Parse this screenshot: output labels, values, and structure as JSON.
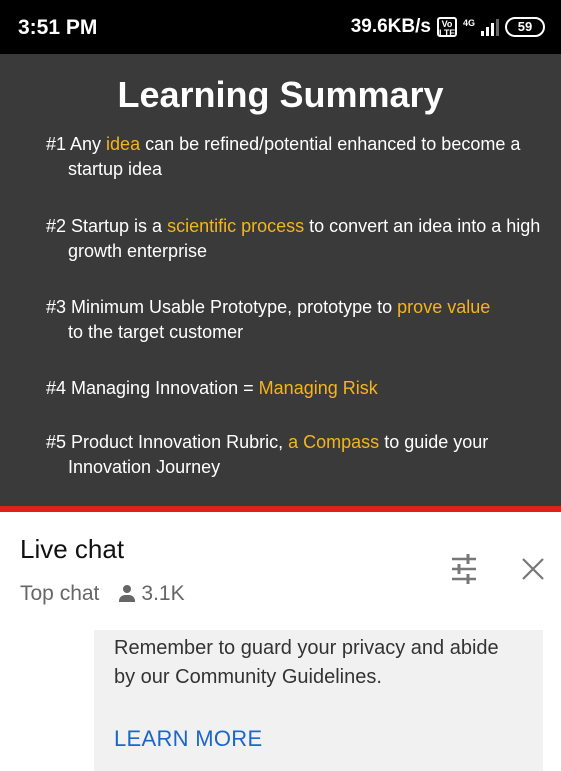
{
  "status_bar": {
    "time": "3:51 PM",
    "speed": "39.6KB/s",
    "volte": "Vo LTE",
    "network": "4G",
    "battery": "59"
  },
  "slide": {
    "title": "Learning Summary",
    "points": [
      {
        "prefix": "#1 Any ",
        "highlight": "idea",
        "suffix": " can be refined/potential enhanced to become a",
        "line2": "startup idea"
      },
      {
        "prefix": "#2 Startup is a ",
        "highlight": "scientific process",
        "suffix": " to convert an idea into a high",
        "line2": "growth enterprise"
      },
      {
        "prefix": "#3 Minimum Usable Prototype, prototype to ",
        "highlight": "prove value",
        "suffix": "",
        "line2": "to the target customer"
      },
      {
        "prefix": "#4 Managing Innovation = ",
        "highlight": "Managing Risk",
        "suffix": "",
        "line2": ""
      },
      {
        "prefix": "#5 Product Innovation Rubric, ",
        "highlight": "a Compass",
        "suffix": " to guide your",
        "line2": "Innovation Journey"
      }
    ]
  },
  "colors": {
    "highlight": "#f6b41c",
    "progress": "#e0201c",
    "link": "#1a67c9",
    "video_bg": "#3a3a3a"
  },
  "chat": {
    "title": "Live chat",
    "mode": "Top chat",
    "viewers": "3.1K",
    "filter_icon": "tune-icon",
    "close_icon": "close-icon",
    "notice": "Remember to guard your privacy and abide by our Community Guidelines.",
    "learn_more": "LEARN MORE"
  }
}
